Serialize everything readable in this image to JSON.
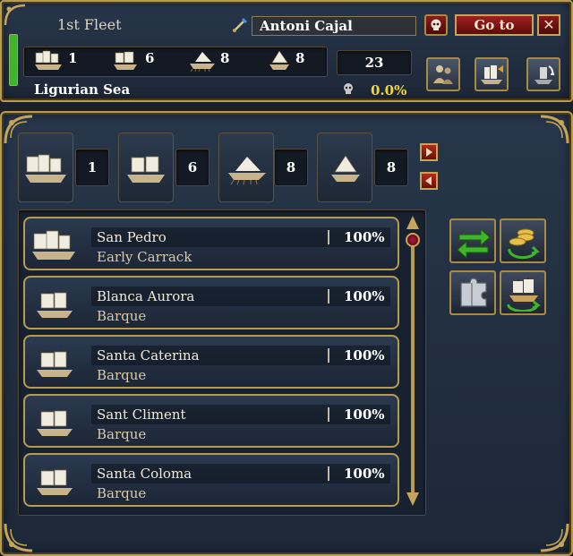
{
  "fleet": {
    "name": "1st Fleet",
    "admiral": "Antoni Cajal",
    "goto_label": "Go to",
    "close_label": "✕",
    "location": "Ligurian Sea",
    "total_ships": "23",
    "attrition": "0.0%",
    "morale_fraction": 1.0,
    "counts": [
      {
        "icon": "heavy-ship-icon",
        "value": "1"
      },
      {
        "icon": "light-ship-icon",
        "value": "6"
      },
      {
        "icon": "galley-icon",
        "value": "8"
      },
      {
        "icon": "transport-icon",
        "value": "8"
      }
    ]
  },
  "types": [
    {
      "icon": "heavy-ship-icon",
      "value": "1"
    },
    {
      "icon": "light-ship-icon",
      "value": "6"
    },
    {
      "icon": "galley-icon",
      "value": "8"
    },
    {
      "icon": "transport-icon",
      "value": "8"
    }
  ],
  "ships": [
    {
      "name": "San Pedro",
      "type": "Early Carrack",
      "strength": "100%"
    },
    {
      "name": "Blanca Aurora",
      "type": "Barque",
      "strength": "100%"
    },
    {
      "name": "Santa Caterina",
      "type": "Barque",
      "strength": "100%"
    },
    {
      "name": "Sant Climent",
      "type": "Barque",
      "strength": "100%"
    },
    {
      "name": "Santa Coloma",
      "type": "Barque",
      "strength": "100%"
    }
  ],
  "colors": {
    "gold": "#b99b4e",
    "panel": "#27364a",
    "attrition": "#f2d53a",
    "morale": "#3fb52a",
    "red_button": "#a02020"
  }
}
